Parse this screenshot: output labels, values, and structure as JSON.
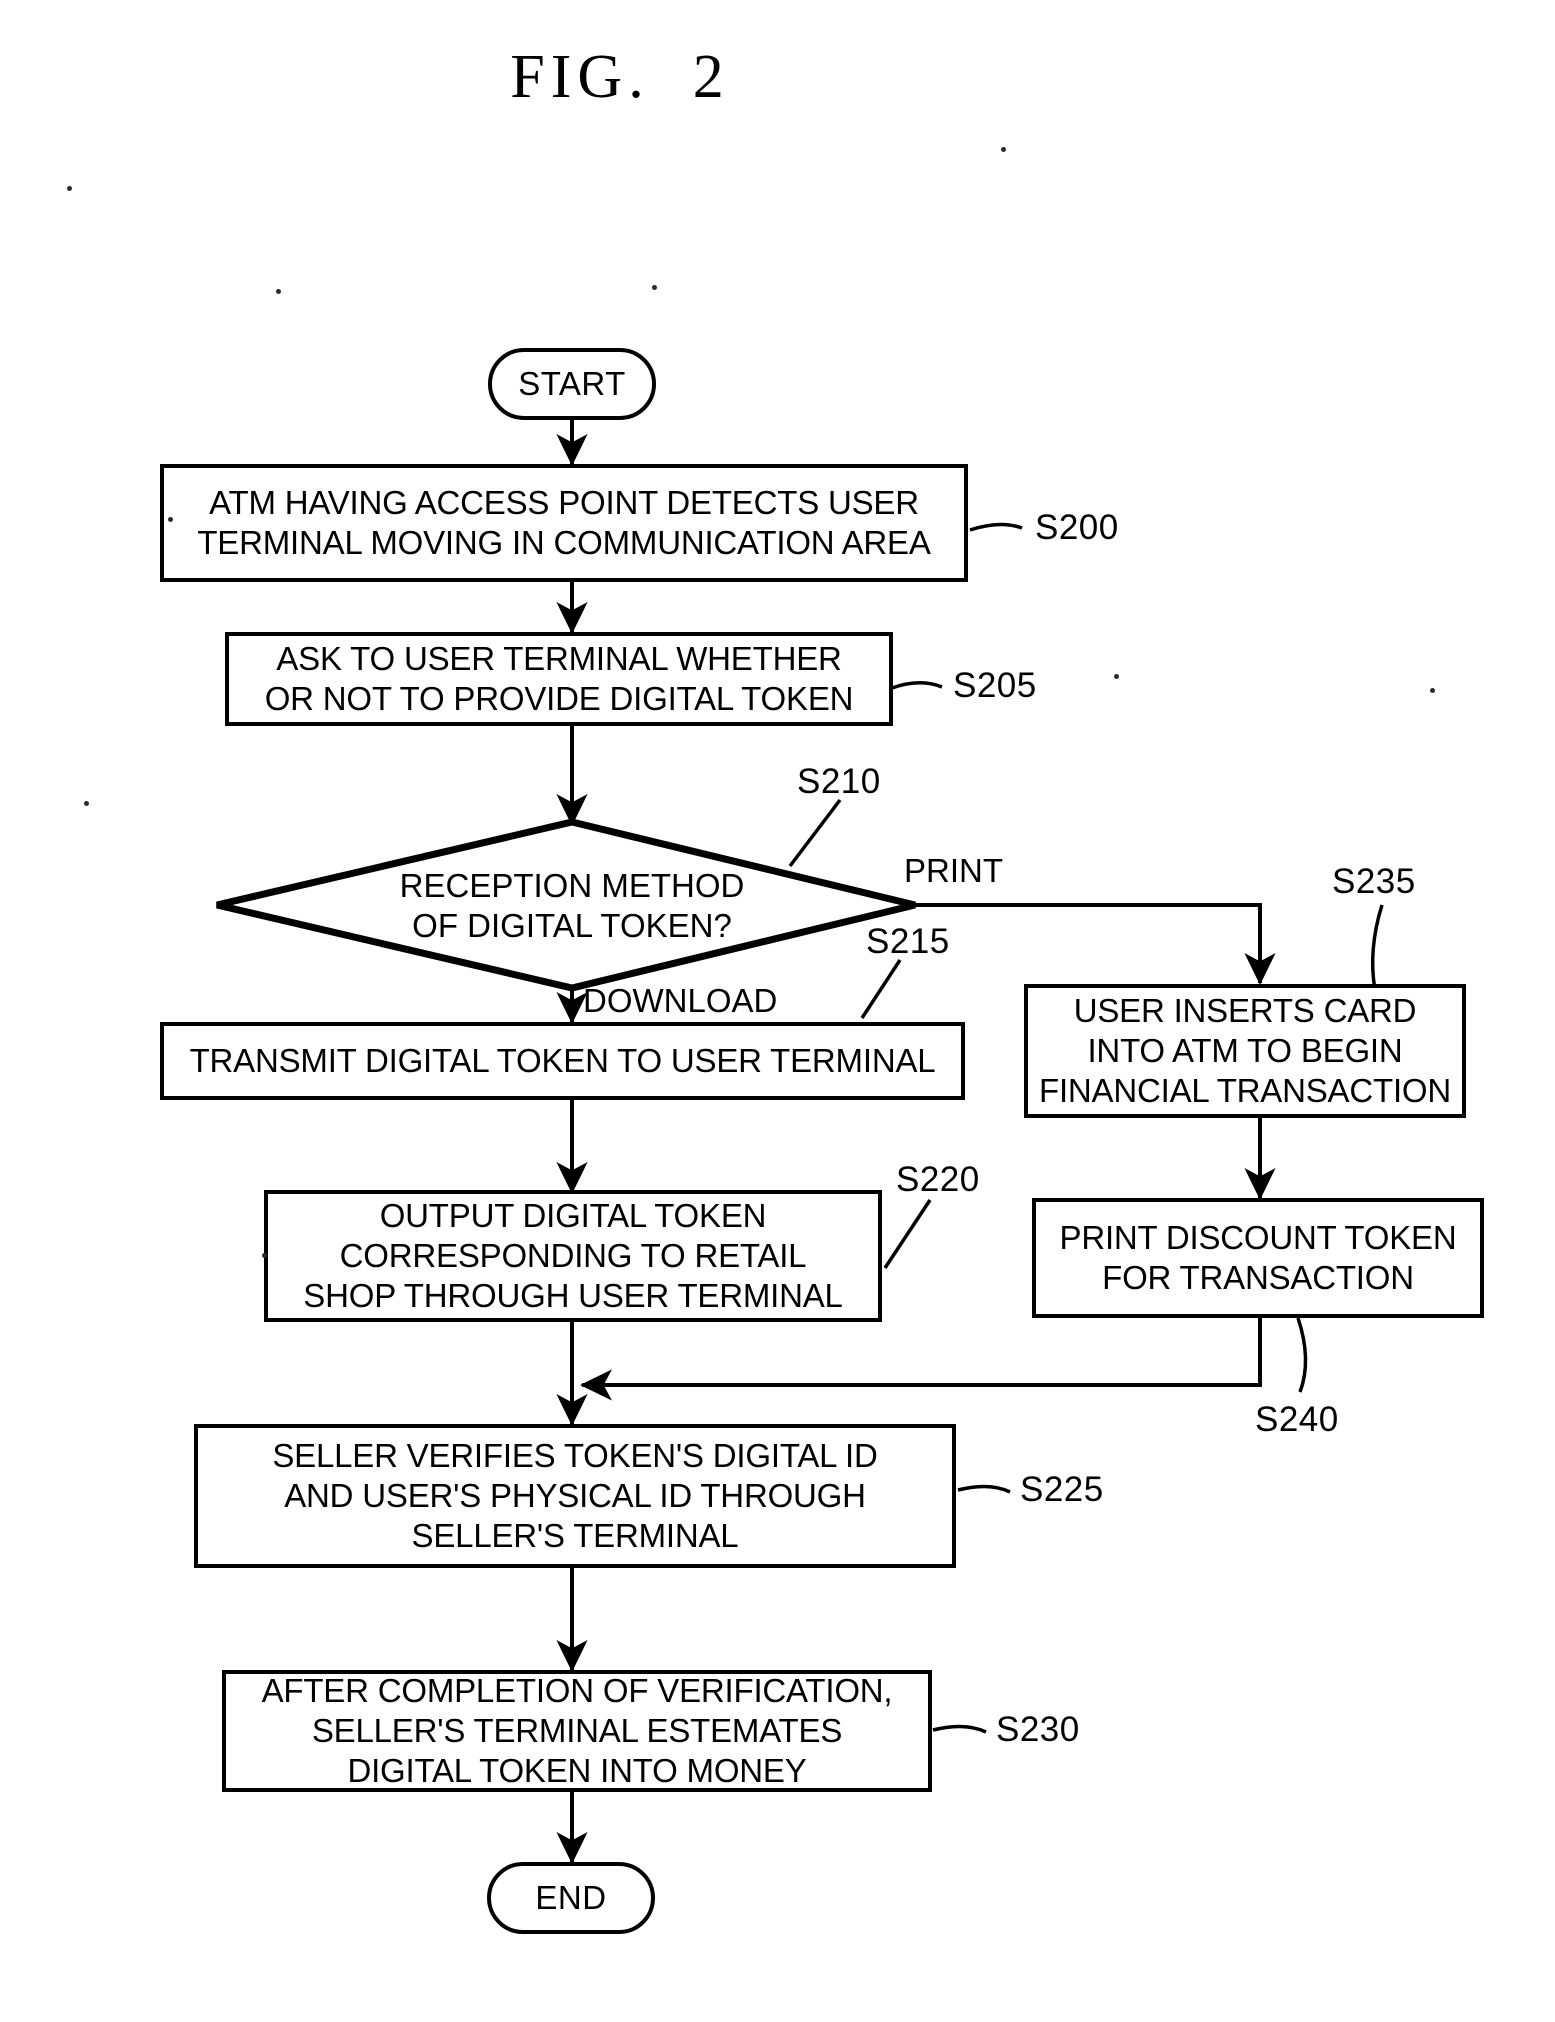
{
  "figure": {
    "title": "FIG.  2",
    "type": "flowchart",
    "document_kind": "patent-drawing"
  },
  "nodes": [
    {
      "id": "start",
      "shape": "terminator",
      "lines": [
        "START"
      ]
    },
    {
      "id": "s200",
      "shape": "process",
      "ref": "S200",
      "lines": [
        "ATM HAVING ACCESS POINT DETECTS USER",
        "TERMINAL MOVING IN COMMUNICATION AREA"
      ]
    },
    {
      "id": "s205",
      "shape": "process",
      "ref": "S205",
      "lines": [
        "ASK TO USER TERMINAL WHETHER",
        "OR NOT TO PROVIDE DIGITAL TOKEN"
      ]
    },
    {
      "id": "s210",
      "shape": "decision",
      "ref": "S210",
      "lines": [
        "RECEPTION METHOD",
        "OF DIGITAL TOKEN?"
      ]
    },
    {
      "id": "s215",
      "shape": "process",
      "ref": "S215",
      "lines": [
        "TRANSMIT DIGITAL TOKEN TO USER TERMINAL"
      ]
    },
    {
      "id": "s220",
      "shape": "process",
      "ref": "S220",
      "lines": [
        "OUTPUT DIGITAL TOKEN",
        "CORRESPONDING TO RETAIL",
        "SHOP THROUGH USER TERMINAL"
      ]
    },
    {
      "id": "s235",
      "shape": "process",
      "ref": "S235",
      "lines": [
        "USER INSERTS CARD",
        "INTO ATM TO BEGIN",
        "FINANCIAL TRANSACTION"
      ]
    },
    {
      "id": "s240",
      "shape": "process",
      "ref": "S240",
      "lines": [
        "PRINT DISCOUNT TOKEN",
        "FOR TRANSACTION"
      ]
    },
    {
      "id": "s225",
      "shape": "process",
      "ref": "S225",
      "lines": [
        "SELLER VERIFIES TOKEN'S DIGITAL ID",
        "AND USER'S PHYSICAL ID THROUGH",
        "SELLER'S TERMINAL"
      ]
    },
    {
      "id": "s230",
      "shape": "process",
      "ref": "S230",
      "lines": [
        "AFTER COMPLETION OF VERIFICATION,",
        "SELLER'S TERMINAL ESTEMATES",
        "DIGITAL TOKEN INTO MONEY"
      ]
    },
    {
      "id": "end",
      "shape": "terminator",
      "lines": [
        "END"
      ]
    }
  ],
  "labels": {
    "start": "START",
    "end": "END",
    "s200_l1": "ATM HAVING ACCESS POINT DETECTS USER",
    "s200_l2": "TERMINAL MOVING IN COMMUNICATION AREA",
    "s205_l1": "ASK TO USER TERMINAL WHETHER",
    "s205_l2": "OR NOT TO PROVIDE DIGITAL TOKEN",
    "s210_l1": "RECEPTION METHOD",
    "s210_l2": "OF DIGITAL TOKEN?",
    "s215_l1": "TRANSMIT DIGITAL TOKEN TO USER TERMINAL",
    "s220_l1": "OUTPUT DIGITAL TOKEN",
    "s220_l2": "CORRESPONDING TO RETAIL",
    "s220_l3": "SHOP THROUGH USER TERMINAL",
    "s235_l1": "USER INSERTS CARD",
    "s235_l2": "INTO ATM TO BEGIN",
    "s235_l3": "FINANCIAL TRANSACTION",
    "s240_l1": "PRINT DISCOUNT TOKEN",
    "s240_l2": "FOR TRANSACTION",
    "s225_l1": "SELLER VERIFIES TOKEN'S DIGITAL ID",
    "s225_l2": "AND USER'S PHYSICAL ID THROUGH",
    "s225_l3": "SELLER'S TERMINAL",
    "s230_l1": "AFTER COMPLETION OF VERIFICATION,",
    "s230_l2": "SELLER'S TERMINAL ESTEMATES",
    "s230_l3": "DIGITAL TOKEN INTO MONEY"
  },
  "refs": {
    "s200": "S200",
    "s205": "S205",
    "s210": "S210",
    "s215": "S215",
    "s220": "S220",
    "s225": "S225",
    "s230": "S230",
    "s235": "S235",
    "s240": "S240"
  },
  "branches": {
    "print": "PRINT",
    "download": "DOWNLOAD"
  },
  "colors": {
    "ink": "#000000",
    "paper": "#ffffff"
  }
}
